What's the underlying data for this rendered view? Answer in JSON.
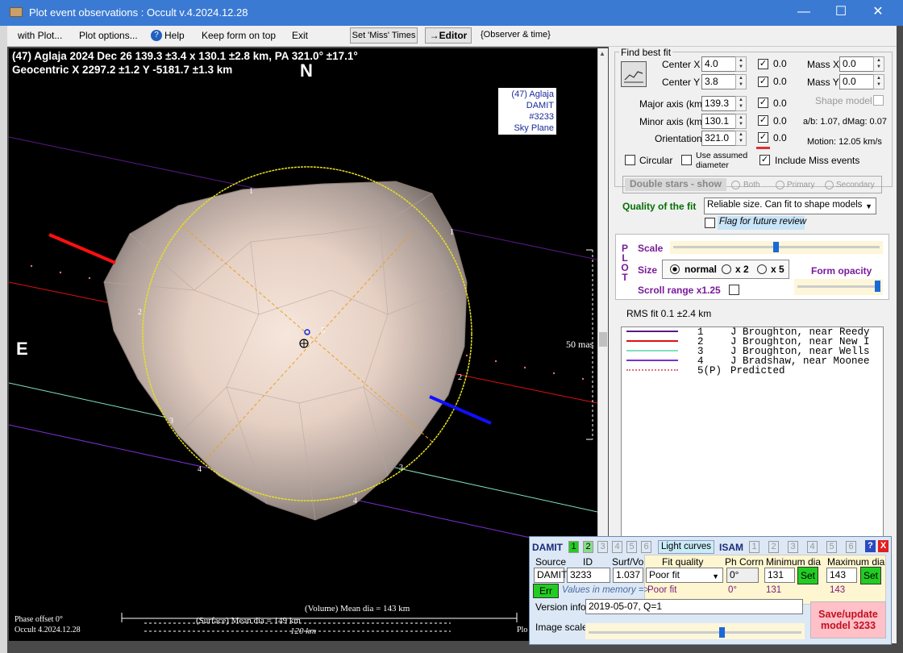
{
  "window": {
    "title": "Plot event observations : Occult v.4.2024.12.28"
  },
  "menu": {
    "items": [
      "with Plot...",
      "Plot options...",
      "Help",
      "Keep form on top",
      "Exit"
    ],
    "set_miss_times": "Set 'Miss' Times",
    "editor": "→Editor",
    "observer_time": "{Observer & time}"
  },
  "plot": {
    "line1": "(47) Aglaja  2024 Dec 26   139.3 ±3.4 x 130.1 ±2.8 km,  PA 321.0° ±17.1°",
    "line2": "Geocentric  X  2297.2 ±1.2  Y -5181.7 ±1.3 km",
    "north": "N",
    "east": "E",
    "info": [
      "(47) Aglaja",
      "DAMIT #3233",
      "Sky Plane"
    ],
    "scale_mas": "50 mas",
    "volume_label": "(Volume) Mean dia = 143 km",
    "surface_label": "(Surface) Mean dia = 149 km",
    "km_label": "120 km",
    "phase_offset": "Phase offset 0°",
    "footer_version": "Occult 4.2024.12.28",
    "footer_right": "Plo",
    "chord_labels": [
      "1",
      "1",
      "2",
      "2",
      "3",
      "3",
      "4",
      "4",
      "5"
    ]
  },
  "fit": {
    "group_title": "Find best fit",
    "center_x": {
      "label": "Center X",
      "value": "4.0",
      "check": "0.0"
    },
    "center_y": {
      "label": "Center Y",
      "value": "3.8",
      "check": "0.0"
    },
    "mass_x": {
      "label": "Mass X",
      "value": "0.0"
    },
    "mass_y": {
      "label": "Mass Y",
      "value": "0.0"
    },
    "major": {
      "label": "Major axis (km)",
      "value": "139.3",
      "check": "0.0"
    },
    "minor": {
      "label": "Minor axis (km)",
      "value": "130.1",
      "check": "0.0"
    },
    "orient": {
      "label": "Orientation",
      "value": "321.0",
      "check": "0.0"
    },
    "shape_model": "Shape model",
    "ab": "a/b: 1.07, dMag: 0.07",
    "motion": "Motion: 12.05 km/s",
    "circular": "Circular",
    "use_assumed": "Use assumed diameter",
    "include_miss": "Include Miss events",
    "double_stars": "Double stars - show",
    "both": "Both",
    "primary": "Primary",
    "secondary": "Secondary",
    "quality_label": "Quality of the fit",
    "quality_value": "Reliable size. Can fit to shape models",
    "flag_review": "Flag for future review"
  },
  "plotctl": {
    "side": "PLOT",
    "scale": "Scale",
    "size": "Size",
    "normal": "normal",
    "x2": "x 2",
    "x5": "x 5",
    "form_opacity": "Form opacity",
    "scroll_range": "Scroll range x1.25",
    "rms": "RMS fit 0.1 ±2.4 km"
  },
  "legend": [
    {
      "num": "1",
      "text": "J Broughton, near Reedy",
      "color": "#5a1a8a"
    },
    {
      "num": "2",
      "text": "J Broughton, near New I",
      "color": "#e01010"
    },
    {
      "num": "3",
      "text": "J Broughton, near Wells",
      "color": "#80e0c0"
    },
    {
      "num": "4",
      "text": "J Bradshaw, near Moonee",
      "color": "#7a30d0"
    },
    {
      "num": "5(P)",
      "text": "Predicted",
      "color": "#e07080"
    }
  ],
  "damit": {
    "title": "DAMIT",
    "tabs": [
      "1",
      "2",
      "3",
      "4",
      "5",
      "6"
    ],
    "light_curves": "Light curves",
    "isam": "ISAM",
    "isam_tabs": [
      "1",
      "2",
      "3",
      "4",
      "5",
      "6"
    ],
    "help": "?",
    "close": "X",
    "hdr_source": "Source",
    "hdr_id": "ID",
    "hdr_surf": "Surf/Vol",
    "hdr_fit": "Fit quality",
    "hdr_phcorr": "Ph Corrn",
    "hdr_min": "Minimum dia",
    "hdr_max": "Maximum dia",
    "source": "DAMIT",
    "id": "3233",
    "surf": "1.037",
    "fit_quality": "Poor fit",
    "phcorr": "0°",
    "min": "131",
    "max": "143",
    "set": "Set",
    "err": "Err",
    "mem_label": "Values in memory =>",
    "mem_fit": "Poor fit",
    "mem_ph": "0°",
    "mem_min": "131",
    "mem_max": "143",
    "version_label": "Version info",
    "version_value": "2019-05-07, Q=1",
    "image_scale": "Image scale",
    "save": "Save/update model 3233"
  }
}
